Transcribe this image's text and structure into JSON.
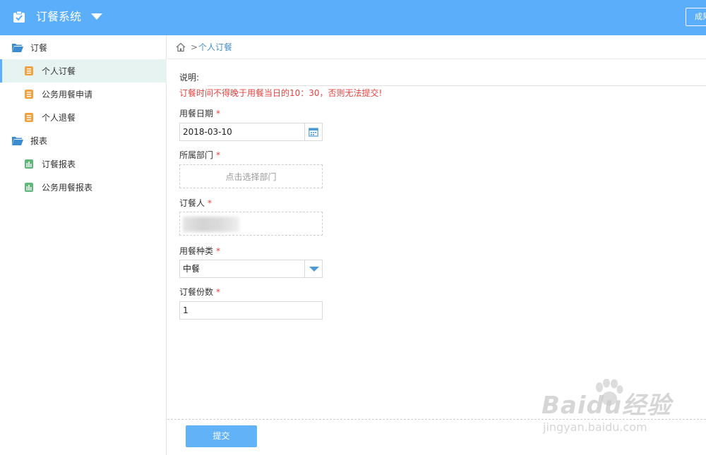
{
  "header": {
    "app_title": "订餐系统",
    "top_button_label": "成果"
  },
  "sidebar": {
    "groups": [
      {
        "label": "订餐",
        "items": [
          {
            "label": "个人订餐",
            "active": true
          },
          {
            "label": "公务用餐申请",
            "active": false
          },
          {
            "label": "个人退餐",
            "active": false
          }
        ]
      },
      {
        "label": "报表",
        "items": [
          {
            "label": "订餐报表",
            "active": false
          },
          {
            "label": "公务用餐报表",
            "active": false
          }
        ]
      }
    ]
  },
  "breadcrumb": {
    "separator": ">",
    "current": "个人订餐"
  },
  "form": {
    "description_label": "说明:",
    "description_text": "订餐时间不得晚于用餐当日的10：30，否则无法提交!",
    "required_mark": "*",
    "date_label": "用餐日期",
    "date_value": "2018-03-10",
    "department_label": "所属部门",
    "department_hint": "点击选择部门",
    "orderer_label": "订餐人",
    "meal_type_label": "用餐种类",
    "meal_type_value": "中餐",
    "count_label": "订餐份数",
    "count_value": "1",
    "submit_label": "提交"
  },
  "watermark": {
    "brand": "Baidu经验",
    "url": "jingyan.baidu.com"
  },
  "colors": {
    "header": "#5aaefa",
    "active_item_bg": "#e6f3f1",
    "error": "#e64340",
    "breadcrumb_link": "#4a90c8",
    "submit": "#62b2f7"
  }
}
